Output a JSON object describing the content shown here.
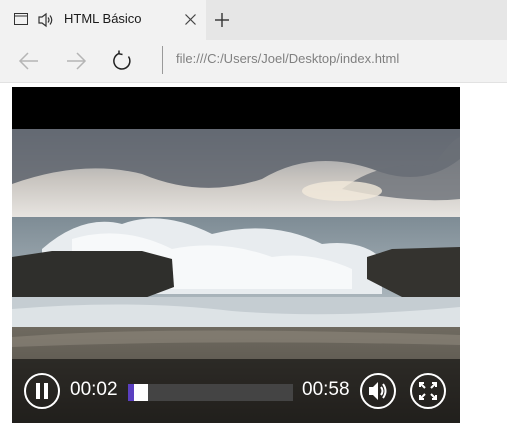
{
  "tab": {
    "title": "HTML Básico"
  },
  "address_bar": {
    "url": "file:///C:/Users/Joel/Desktop/index.html"
  },
  "video": {
    "current_time": "00:02",
    "duration": "00:58",
    "progress_fraction": 0.034,
    "playing": true
  },
  "icons": {
    "tab_page": "page-icon",
    "tab_audio": "speaker-icon",
    "tab_close": "close-icon",
    "new_tab": "plus-icon",
    "back": "arrow-left-icon",
    "forward": "arrow-right-icon",
    "refresh": "refresh-icon",
    "pause": "pause-icon",
    "volume": "volume-icon",
    "fullscreen": "fullscreen-icon"
  },
  "colors": {
    "progress_played": "#5a3fc0",
    "progress_track": "#444444"
  }
}
